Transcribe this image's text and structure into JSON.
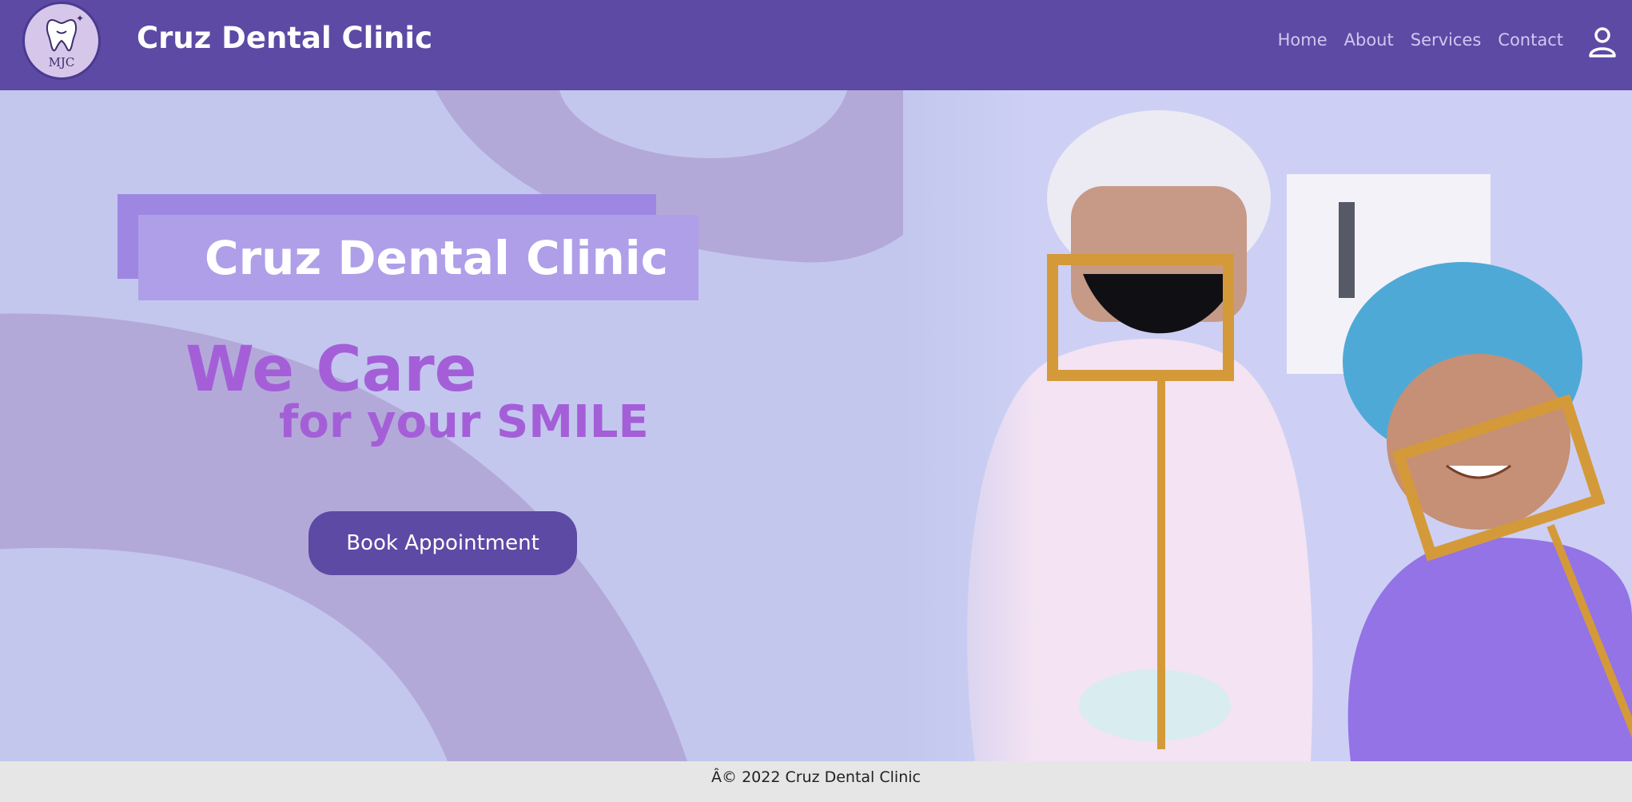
{
  "header": {
    "logo_text": "MJC",
    "brand": "Cruz Dental Clinic",
    "nav": [
      "Home",
      "About",
      "Services",
      "Contact"
    ],
    "user_icon": "user-icon"
  },
  "hero": {
    "title": "Cruz Dental Clinic",
    "tagline_1": "We Care",
    "tagline_2": "for your SMILE",
    "button_label": "Book Appointment",
    "photo": "dentist-and-patient-photo-icon"
  },
  "footer": {
    "text": "Â© 2022 Cruz Dental Clinic"
  },
  "colors": {
    "header": "#5c4aa4",
    "hero_bg": "#c3c7ee",
    "accent_text": "#a45fd8",
    "button": "#5c4aa4",
    "footer": "#e6e6e6"
  }
}
